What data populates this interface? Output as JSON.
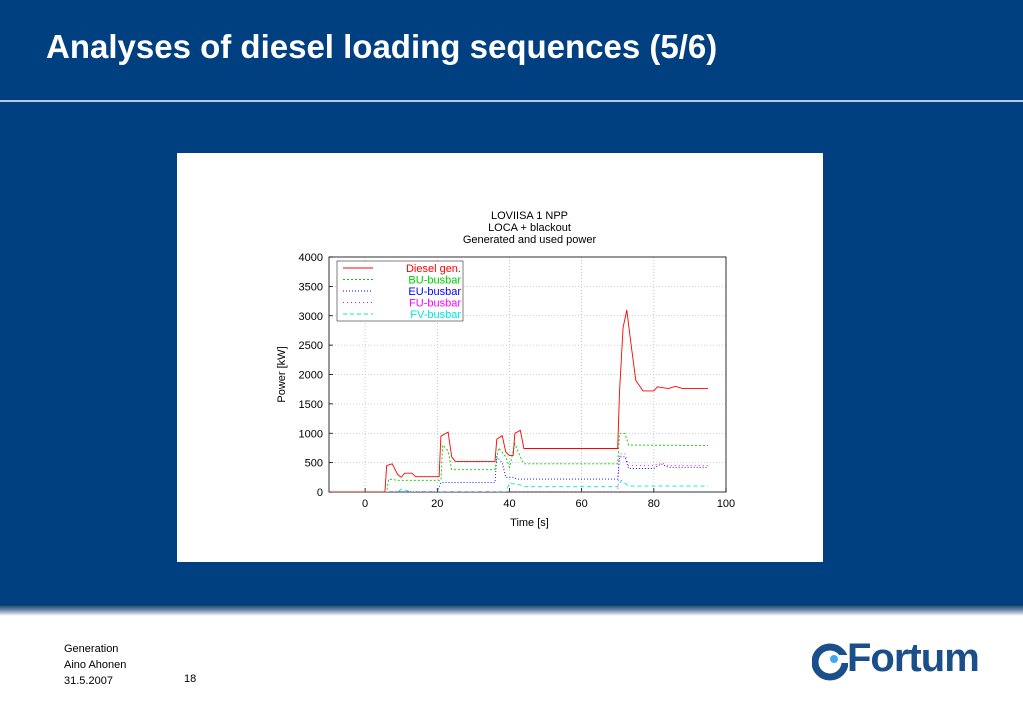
{
  "slide": {
    "title": "Analyses of diesel loading sequences (5/6)"
  },
  "footer": {
    "department": "Generation",
    "author": "Aino Ahonen",
    "date": "31.5.2007",
    "page": "18",
    "logo_text": "Fortum"
  },
  "colors": {
    "header_bg": "#004080",
    "logo": "#1b4f8c"
  },
  "chart_data": {
    "type": "line",
    "title_lines": [
      "LOVIISA 1 NPP",
      "LOCA + blackout",
      "Generated and used power"
    ],
    "xlabel": "Time [s]",
    "ylabel": "Power [kW]",
    "xlim": [
      -10,
      100
    ],
    "ylim": [
      0,
      4000
    ],
    "xticks": [
      0,
      20,
      40,
      60,
      80,
      100
    ],
    "yticks": [
      0,
      500,
      1000,
      1500,
      2000,
      2500,
      3000,
      3500,
      4000
    ],
    "grid": true,
    "legend_position": "top-left",
    "series": [
      {
        "name": "Diesel gen.",
        "color": "#ff0000",
        "dash": "",
        "points": [
          [
            -10,
            0
          ],
          [
            5.5,
            0
          ],
          [
            6,
            450
          ],
          [
            7.5,
            480
          ],
          [
            9,
            300
          ],
          [
            10,
            250
          ],
          [
            11,
            320
          ],
          [
            13,
            320
          ],
          [
            14,
            260
          ],
          [
            20.5,
            260
          ],
          [
            21,
            950
          ],
          [
            23,
            1020
          ],
          [
            24,
            600
          ],
          [
            25,
            520
          ],
          [
            36,
            520
          ],
          [
            36.5,
            900
          ],
          [
            38,
            960
          ],
          [
            39,
            680
          ],
          [
            40,
            620
          ],
          [
            41,
            620
          ],
          [
            41.5,
            1000
          ],
          [
            43,
            1050
          ],
          [
            44,
            740
          ],
          [
            70,
            740
          ],
          [
            70.5,
            1700
          ],
          [
            71.5,
            2800
          ],
          [
            72.5,
            3100
          ],
          [
            73.5,
            2600
          ],
          [
            75,
            1900
          ],
          [
            77,
            1720
          ],
          [
            80,
            1720
          ],
          [
            81,
            1790
          ],
          [
            84,
            1760
          ],
          [
            86,
            1800
          ],
          [
            88,
            1760
          ],
          [
            95,
            1760
          ]
        ]
      },
      {
        "name": "BU-busbar",
        "color": "#00cc00",
        "dash": "2,2",
        "points": [
          [
            -10,
            0
          ],
          [
            6,
            0
          ],
          [
            6.5,
            220
          ],
          [
            9,
            200
          ],
          [
            21,
            200
          ],
          [
            21.5,
            800
          ],
          [
            23,
            700
          ],
          [
            24,
            380
          ],
          [
            36,
            380
          ],
          [
            37,
            750
          ],
          [
            39,
            600
          ],
          [
            40,
            420
          ],
          [
            41.5,
            820
          ],
          [
            43,
            600
          ],
          [
            44,
            480
          ],
          [
            70,
            480
          ],
          [
            70.5,
            1000
          ],
          [
            72,
            1000
          ],
          [
            73,
            800
          ],
          [
            95,
            790
          ]
        ]
      },
      {
        "name": "EU-busbar",
        "color": "#0000ff",
        "dash": "1,2",
        "points": [
          [
            -10,
            0
          ],
          [
            20,
            0
          ],
          [
            21,
            160
          ],
          [
            36,
            160
          ],
          [
            36.5,
            600
          ],
          [
            38,
            500
          ],
          [
            39,
            250
          ],
          [
            41,
            250
          ],
          [
            42,
            220
          ],
          [
            70,
            220
          ],
          [
            70.5,
            600
          ],
          [
            72,
            600
          ],
          [
            73,
            400
          ],
          [
            80,
            400
          ],
          [
            82,
            480
          ],
          [
            84,
            420
          ],
          [
            95,
            420
          ]
        ]
      },
      {
        "name": "FU-busbar",
        "color": "#ff00ff",
        "dash": "1,3",
        "points": [
          [
            -10,
            0
          ],
          [
            70,
            0
          ],
          [
            70.5,
            650
          ],
          [
            72,
            650
          ],
          [
            73,
            450
          ],
          [
            80,
            450
          ],
          [
            82,
            500
          ],
          [
            84,
            450
          ],
          [
            95,
            450
          ]
        ]
      },
      {
        "name": "FV-busbar",
        "color": "#00e5e5",
        "dash": "4,3",
        "points": [
          [
            -10,
            0
          ],
          [
            9,
            0
          ],
          [
            10,
            50
          ],
          [
            13,
            0
          ],
          [
            39,
            0
          ],
          [
            40,
            150
          ],
          [
            43,
            120
          ],
          [
            44,
            90
          ],
          [
            70,
            90
          ],
          [
            71,
            200
          ],
          [
            73,
            100
          ],
          [
            95,
            100
          ]
        ]
      }
    ]
  }
}
